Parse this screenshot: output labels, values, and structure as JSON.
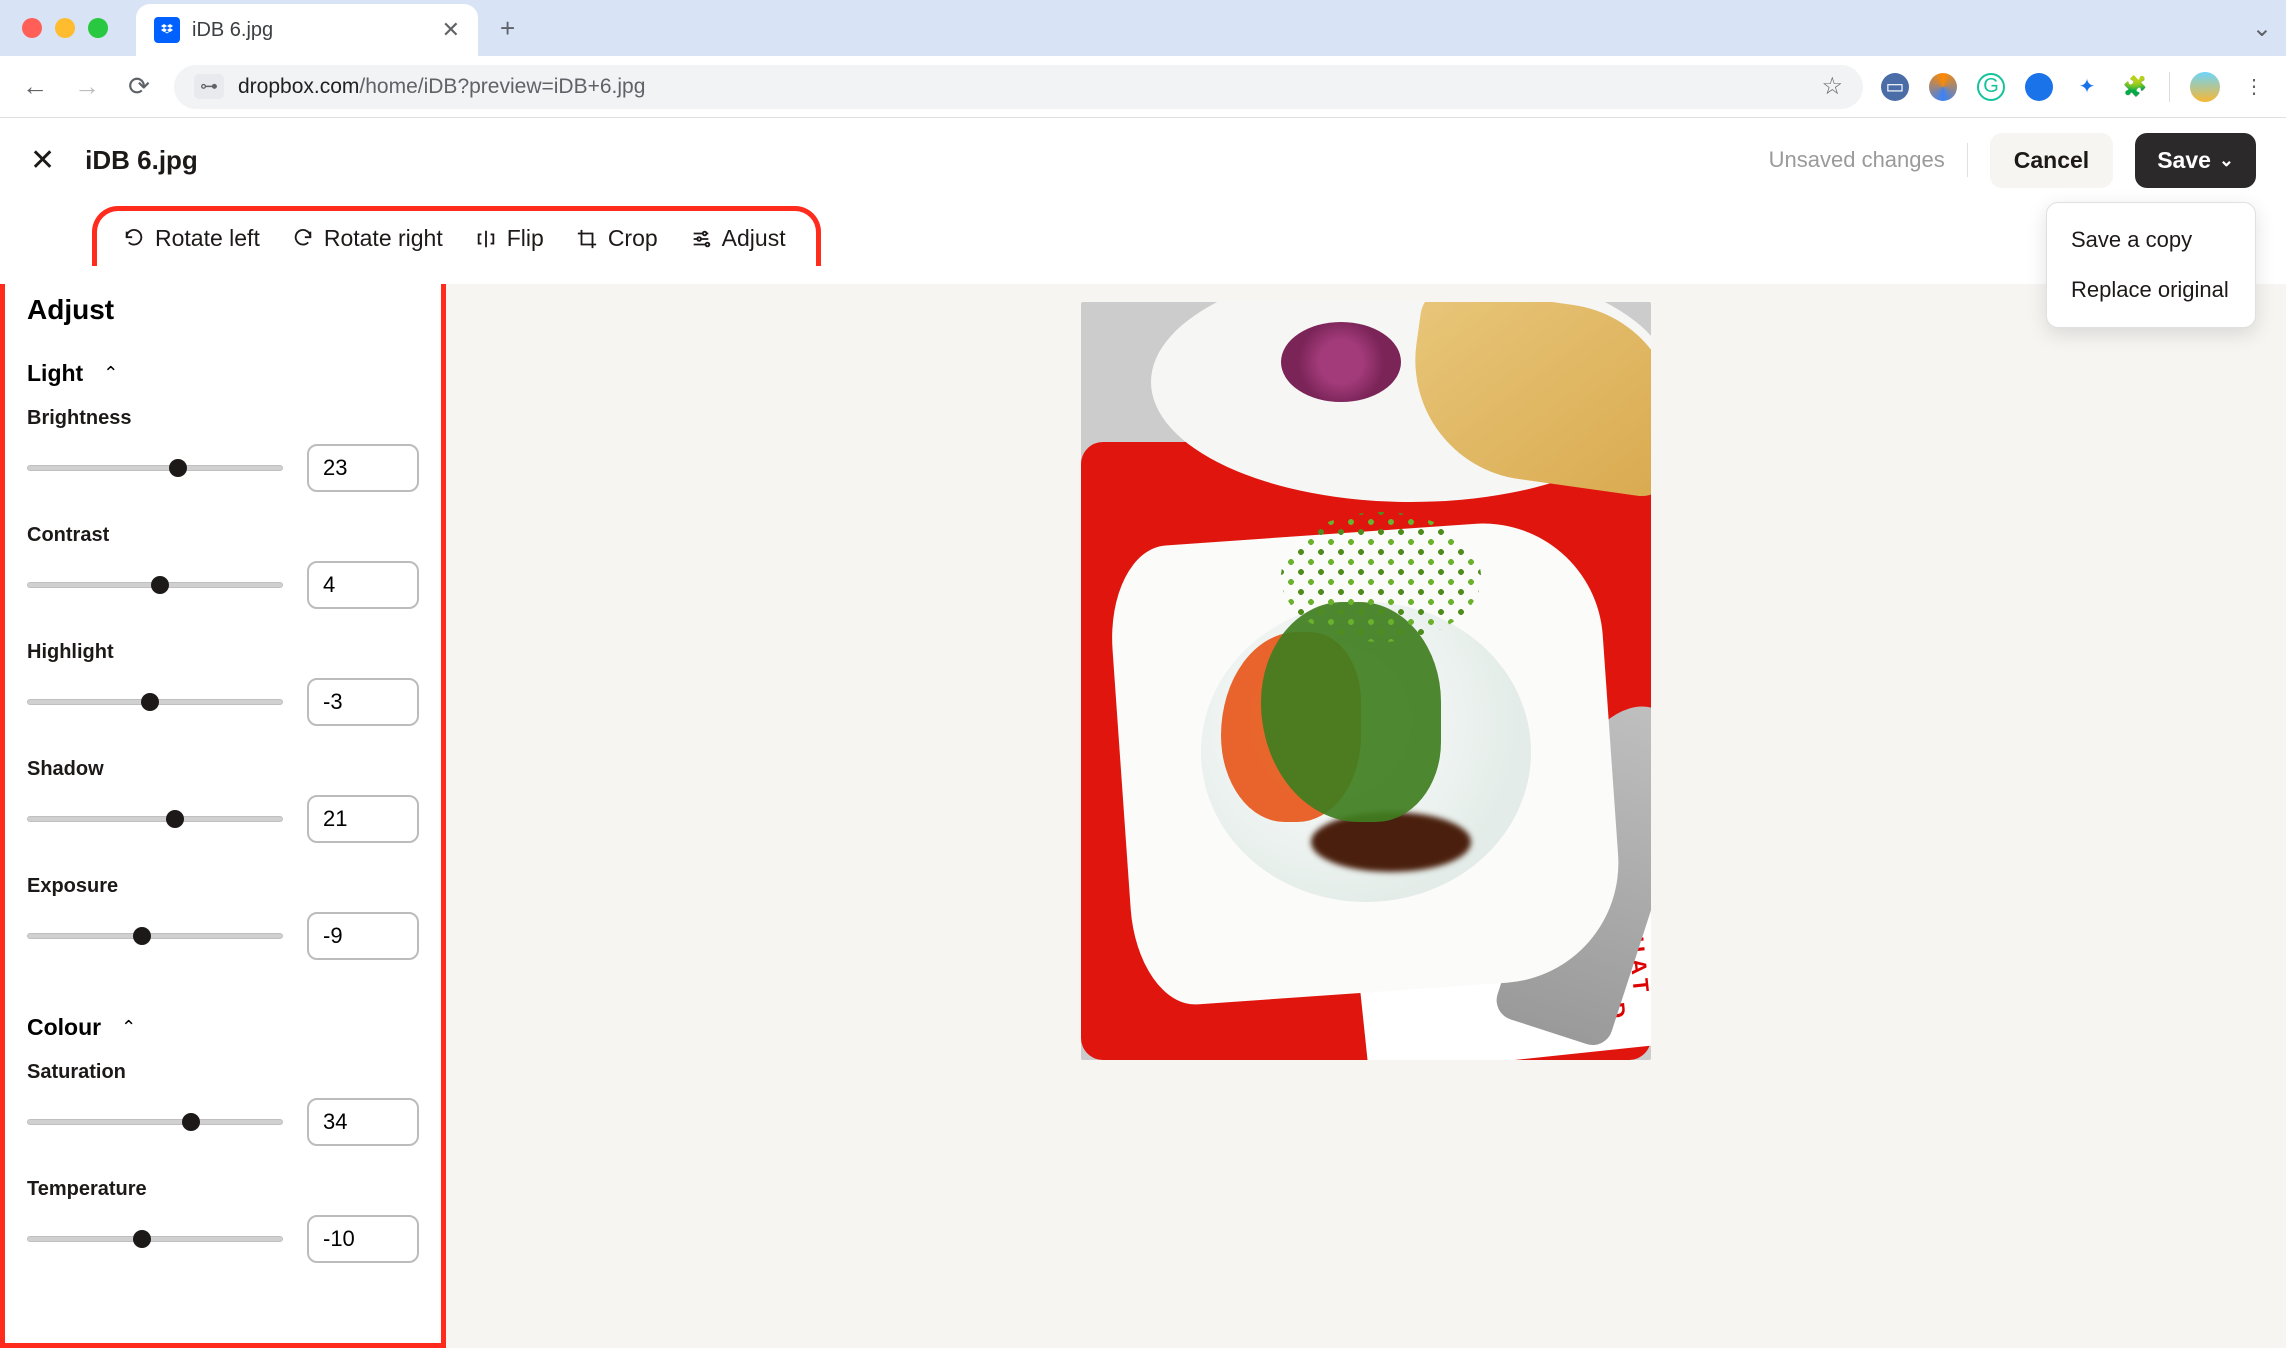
{
  "browser": {
    "tab_title": "iDB 6.jpg",
    "url_domain": "dropbox.com",
    "url_path": "/home/iDB?preview=iDB+6.jpg"
  },
  "header": {
    "filename": "iDB 6.jpg",
    "unsaved": "Unsaved changes",
    "cancel": "Cancel",
    "save": "Save",
    "save_menu": {
      "save_copy": "Save a copy",
      "replace": "Replace original"
    }
  },
  "toolbar": {
    "rotate_left": "Rotate left",
    "rotate_right": "Rotate right",
    "flip": "Flip",
    "crop": "Crop",
    "adjust": "Adjust"
  },
  "panel": {
    "title": "Adjust",
    "light": {
      "heading": "Light",
      "brightness": {
        "label": "Brightness",
        "value": "23",
        "pos": 59
      },
      "contrast": {
        "label": "Contrast",
        "value": "4",
        "pos": 52
      },
      "highlight": {
        "label": "Highlight",
        "value": "-3",
        "pos": 48
      },
      "shadow": {
        "label": "Shadow",
        "value": "21",
        "pos": 58
      },
      "exposure": {
        "label": "Exposure",
        "value": "-9",
        "pos": 45
      }
    },
    "colour": {
      "heading": "Colour",
      "saturation": {
        "label": "Saturation",
        "value": "34",
        "pos": 64
      },
      "temperature": {
        "label": "Temperature",
        "value": "-10",
        "pos": 45
      }
    }
  }
}
